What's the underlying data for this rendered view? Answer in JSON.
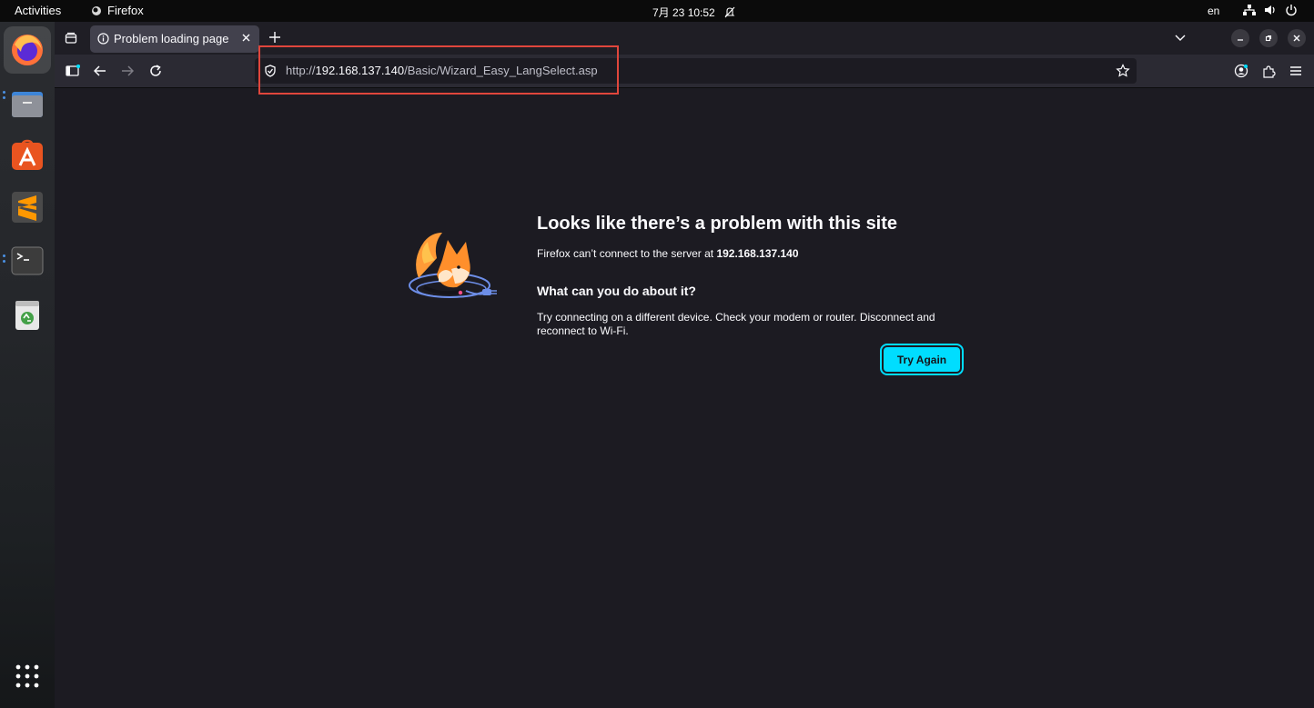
{
  "topbar": {
    "activities": "Activities",
    "app_name": "Firefox",
    "clock": "7月 23  10:52",
    "language": "en"
  },
  "dock": {
    "items": [
      "firefox-icon",
      "files-icon",
      "app-center-icon",
      "sublime-text-icon",
      "terminal-icon",
      "trash-icon",
      "show-apps-icon"
    ]
  },
  "browser": {
    "tab": {
      "title": "Problem loading page"
    },
    "url": {
      "scheme": "http://",
      "host": "192.168.137.140",
      "path": "/Basic/Wizard_Easy_LangSelect.asp"
    }
  },
  "error_page": {
    "title": "Looks like there’s a problem with this site",
    "description_prefix": "Firefox can’t connect to the server at ",
    "server": "192.168.137.140",
    "subtitle": "What can you do about it?",
    "advice": "Try connecting on a different device. Check your modem or router. Disconnect and reconnect to Wi-Fi.",
    "button": "Try Again"
  },
  "colors": {
    "page_bg": "#1c1b22",
    "accent": "#00ddff",
    "annotation": "#e0463c"
  }
}
